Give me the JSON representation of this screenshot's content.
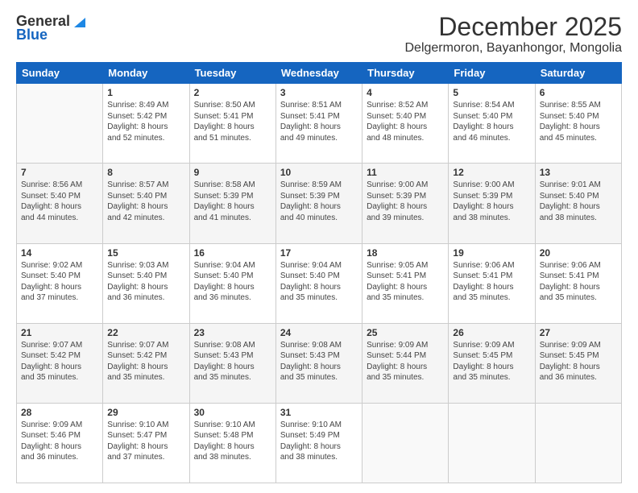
{
  "logo": {
    "line1": "General",
    "line2": "Blue"
  },
  "title": "December 2025",
  "subtitle": "Delgermoron, Bayanhongor, Mongolia",
  "days_of_week": [
    "Sunday",
    "Monday",
    "Tuesday",
    "Wednesday",
    "Thursday",
    "Friday",
    "Saturday"
  ],
  "weeks": [
    [
      {
        "day": "",
        "text": ""
      },
      {
        "day": "1",
        "text": "Sunrise: 8:49 AM\nSunset: 5:42 PM\nDaylight: 8 hours\nand 52 minutes."
      },
      {
        "day": "2",
        "text": "Sunrise: 8:50 AM\nSunset: 5:41 PM\nDaylight: 8 hours\nand 51 minutes."
      },
      {
        "day": "3",
        "text": "Sunrise: 8:51 AM\nSunset: 5:41 PM\nDaylight: 8 hours\nand 49 minutes."
      },
      {
        "day": "4",
        "text": "Sunrise: 8:52 AM\nSunset: 5:40 PM\nDaylight: 8 hours\nand 48 minutes."
      },
      {
        "day": "5",
        "text": "Sunrise: 8:54 AM\nSunset: 5:40 PM\nDaylight: 8 hours\nand 46 minutes."
      },
      {
        "day": "6",
        "text": "Sunrise: 8:55 AM\nSunset: 5:40 PM\nDaylight: 8 hours\nand 45 minutes."
      }
    ],
    [
      {
        "day": "7",
        "text": "Sunrise: 8:56 AM\nSunset: 5:40 PM\nDaylight: 8 hours\nand 44 minutes."
      },
      {
        "day": "8",
        "text": "Sunrise: 8:57 AM\nSunset: 5:40 PM\nDaylight: 8 hours\nand 42 minutes."
      },
      {
        "day": "9",
        "text": "Sunrise: 8:58 AM\nSunset: 5:39 PM\nDaylight: 8 hours\nand 41 minutes."
      },
      {
        "day": "10",
        "text": "Sunrise: 8:59 AM\nSunset: 5:39 PM\nDaylight: 8 hours\nand 40 minutes."
      },
      {
        "day": "11",
        "text": "Sunrise: 9:00 AM\nSunset: 5:39 PM\nDaylight: 8 hours\nand 39 minutes."
      },
      {
        "day": "12",
        "text": "Sunrise: 9:00 AM\nSunset: 5:39 PM\nDaylight: 8 hours\nand 38 minutes."
      },
      {
        "day": "13",
        "text": "Sunrise: 9:01 AM\nSunset: 5:40 PM\nDaylight: 8 hours\nand 38 minutes."
      }
    ],
    [
      {
        "day": "14",
        "text": "Sunrise: 9:02 AM\nSunset: 5:40 PM\nDaylight: 8 hours\nand 37 minutes."
      },
      {
        "day": "15",
        "text": "Sunrise: 9:03 AM\nSunset: 5:40 PM\nDaylight: 8 hours\nand 36 minutes."
      },
      {
        "day": "16",
        "text": "Sunrise: 9:04 AM\nSunset: 5:40 PM\nDaylight: 8 hours\nand 36 minutes."
      },
      {
        "day": "17",
        "text": "Sunrise: 9:04 AM\nSunset: 5:40 PM\nDaylight: 8 hours\nand 35 minutes."
      },
      {
        "day": "18",
        "text": "Sunrise: 9:05 AM\nSunset: 5:41 PM\nDaylight: 8 hours\nand 35 minutes."
      },
      {
        "day": "19",
        "text": "Sunrise: 9:06 AM\nSunset: 5:41 PM\nDaylight: 8 hours\nand 35 minutes."
      },
      {
        "day": "20",
        "text": "Sunrise: 9:06 AM\nSunset: 5:41 PM\nDaylight: 8 hours\nand 35 minutes."
      }
    ],
    [
      {
        "day": "21",
        "text": "Sunrise: 9:07 AM\nSunset: 5:42 PM\nDaylight: 8 hours\nand 35 minutes."
      },
      {
        "day": "22",
        "text": "Sunrise: 9:07 AM\nSunset: 5:42 PM\nDaylight: 8 hours\nand 35 minutes."
      },
      {
        "day": "23",
        "text": "Sunrise: 9:08 AM\nSunset: 5:43 PM\nDaylight: 8 hours\nand 35 minutes."
      },
      {
        "day": "24",
        "text": "Sunrise: 9:08 AM\nSunset: 5:43 PM\nDaylight: 8 hours\nand 35 minutes."
      },
      {
        "day": "25",
        "text": "Sunrise: 9:09 AM\nSunset: 5:44 PM\nDaylight: 8 hours\nand 35 minutes."
      },
      {
        "day": "26",
        "text": "Sunrise: 9:09 AM\nSunset: 5:45 PM\nDaylight: 8 hours\nand 35 minutes."
      },
      {
        "day": "27",
        "text": "Sunrise: 9:09 AM\nSunset: 5:45 PM\nDaylight: 8 hours\nand 36 minutes."
      }
    ],
    [
      {
        "day": "28",
        "text": "Sunrise: 9:09 AM\nSunset: 5:46 PM\nDaylight: 8 hours\nand 36 minutes."
      },
      {
        "day": "29",
        "text": "Sunrise: 9:10 AM\nSunset: 5:47 PM\nDaylight: 8 hours\nand 37 minutes."
      },
      {
        "day": "30",
        "text": "Sunrise: 9:10 AM\nSunset: 5:48 PM\nDaylight: 8 hours\nand 38 minutes."
      },
      {
        "day": "31",
        "text": "Sunrise: 9:10 AM\nSunset: 5:49 PM\nDaylight: 8 hours\nand 38 minutes."
      },
      {
        "day": "",
        "text": ""
      },
      {
        "day": "",
        "text": ""
      },
      {
        "day": "",
        "text": ""
      }
    ]
  ]
}
